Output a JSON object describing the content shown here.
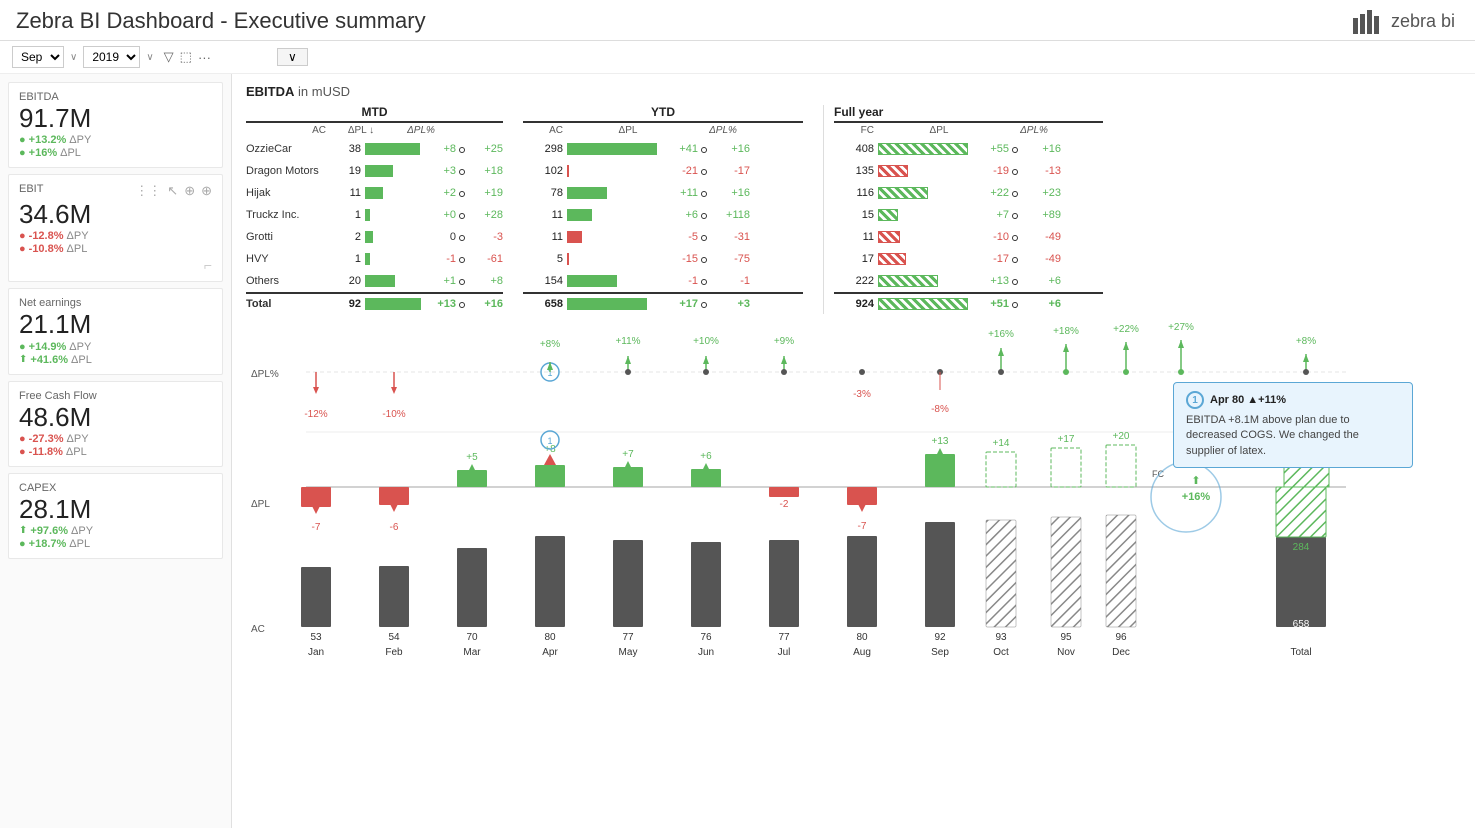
{
  "header": {
    "title": "Zebra BI Dashboard - Executive summary",
    "logo": "zebra bi",
    "logo_icon": "bar-chart-icon"
  },
  "toolbar": {
    "month_select": "Sep",
    "year_select": "2019",
    "filter_label": "Filter",
    "collapse_label": "∨"
  },
  "kpis": [
    {
      "id": "ebitda",
      "label": "EBITDA",
      "value": "91.7M",
      "metrics": [
        {
          "sign": "+",
          "val": "+13.2%",
          "type": "green",
          "tag": "ΔPY"
        },
        {
          "sign": "+",
          "val": "+16%",
          "type": "green",
          "tag": "ΔPL"
        }
      ]
    },
    {
      "id": "ebit",
      "label": "EBIT",
      "value": "34.6M",
      "metrics": [
        {
          "sign": "-",
          "val": "-12.8%",
          "type": "red",
          "tag": "ΔPY"
        },
        {
          "sign": "-",
          "val": "-10.8%",
          "type": "red",
          "tag": "ΔPL"
        }
      ]
    },
    {
      "id": "net-earnings",
      "label": "Net earnings",
      "value": "21.1M",
      "metrics": [
        {
          "sign": "+",
          "val": "+14.9%",
          "type": "green",
          "tag": "ΔPY"
        },
        {
          "sign": "+",
          "val": "+41.6%",
          "type": "green",
          "tag": "ΔPL"
        }
      ]
    },
    {
      "id": "free-cash-flow",
      "label": "Free Cash Flow",
      "value": "48.6M",
      "metrics": [
        {
          "sign": "-",
          "val": "-27.3%",
          "type": "red",
          "tag": "ΔPY"
        },
        {
          "sign": "-",
          "val": "-11.8%",
          "type": "red",
          "tag": "ΔPL"
        }
      ]
    },
    {
      "id": "capex",
      "label": "CAPEX",
      "value": "28.1M",
      "metrics": [
        {
          "sign": "+",
          "val": "+97.6%",
          "type": "green",
          "tag": "ΔPY"
        },
        {
          "sign": "+",
          "val": "+18.7%",
          "type": "green",
          "tag": "ΔPL"
        }
      ]
    }
  ],
  "ebitda_title": "EBITDA",
  "ebitda_unit": "in mUSD",
  "mtd_header": "MTD",
  "ytd_header": "YTD",
  "full_year_header": "Full year",
  "col_headers": {
    "ac": "AC",
    "dpl_down": "ΔPL ↓",
    "dpl_pct": "ΔPL%",
    "fc": "FC",
    "dpl": "ΔPL",
    "dpl_pct2": "ΔPL%"
  },
  "table_rows": [
    {
      "name": "OzzieCar",
      "mtd_ac": 38,
      "mtd_bar_w": 55,
      "mtd_dpl": "+8",
      "mtd_dpl_pct": "+25",
      "ytd_ac": 298,
      "ytd_bar_w": 90,
      "ytd_dpl": "+41",
      "ytd_dpl_pct": "+16",
      "fy_fc": 408,
      "fy_bar_w": 90,
      "fy_dpl": "+55",
      "fy_dpl_pct": "+16",
      "ytd_bar_color": "green",
      "fy_bar_type": "hatch"
    },
    {
      "name": "Dragon Motors",
      "mtd_ac": 19,
      "mtd_bar_w": 28,
      "mtd_dpl": "+3",
      "mtd_dpl_pct": "+18",
      "ytd_ac": 102,
      "ytd_bar_w": 0,
      "ytd_dpl": "-21",
      "ytd_dpl_pct": "-17",
      "fy_fc": 135,
      "fy_bar_w": 30,
      "fy_dpl": "-19",
      "fy_dpl_pct": "-13",
      "ytd_bar_color": "red",
      "fy_bar_type": "hatch-red"
    },
    {
      "name": "Hijak",
      "mtd_ac": 11,
      "mtd_bar_w": 18,
      "mtd_dpl": "+2",
      "mtd_dpl_pct": "+19",
      "ytd_ac": 78,
      "ytd_bar_w": 40,
      "ytd_dpl": "+11",
      "ytd_dpl_pct": "+16",
      "fy_fc": 116,
      "fy_bar_w": 50,
      "fy_dpl": "+22",
      "fy_dpl_pct": "+23",
      "ytd_bar_color": "green",
      "fy_bar_type": "hatch"
    },
    {
      "name": "Truckz Inc.",
      "mtd_ac": 1,
      "mtd_bar_w": 5,
      "mtd_dpl": "+0",
      "mtd_dpl_pct": "+28",
      "ytd_ac": 11,
      "ytd_bar_w": 25,
      "ytd_dpl": "+6",
      "ytd_dpl_pct": "+118",
      "fy_fc": 15,
      "fy_bar_w": 20,
      "fy_dpl": "+7",
      "fy_dpl_pct": "+89",
      "ytd_bar_color": "green",
      "fy_bar_type": "hatch"
    },
    {
      "name": "Grotti",
      "mtd_ac": 2,
      "mtd_bar_w": 8,
      "mtd_dpl": "0",
      "mtd_dpl_pct": "-3",
      "ytd_ac": 11,
      "ytd_bar_w": 15,
      "ytd_dpl": "-5",
      "ytd_dpl_pct": "-31",
      "fy_fc": 11,
      "fy_bar_w": 22,
      "fy_dpl": "-10",
      "fy_dpl_pct": "-49",
      "ytd_bar_color": "red",
      "fy_bar_type": "hatch-red"
    },
    {
      "name": "HVY",
      "mtd_ac": 1,
      "mtd_bar_w": 5,
      "mtd_dpl": "-1",
      "mtd_dpl_pct": "-61",
      "ytd_ac": 5,
      "ytd_bar_w": 0,
      "ytd_dpl": "-15",
      "ytd_dpl_pct": "-75",
      "fy_fc": 17,
      "fy_bar_w": 28,
      "fy_dpl": "-17",
      "fy_dpl_pct": "-49",
      "ytd_bar_color": "red",
      "fy_bar_type": "hatch-red"
    },
    {
      "name": "Others",
      "mtd_ac": 20,
      "mtd_bar_w": 30,
      "mtd_dpl": "+1",
      "mtd_dpl_pct": "+8",
      "ytd_ac": 154,
      "ytd_bar_w": 50,
      "ytd_dpl": "-1",
      "ytd_dpl_pct": "-1",
      "fy_fc": 222,
      "fy_bar_w": 60,
      "fy_dpl": "+13",
      "fy_dpl_pct": "+6",
      "ytd_bar_color": "green",
      "fy_bar_type": "hatch"
    },
    {
      "name": "Total",
      "mtd_ac": 92,
      "mtd_bar_w": 70,
      "mtd_dpl": "+13",
      "mtd_dpl_pct": "+16",
      "ytd_ac": 658,
      "ytd_bar_w": 80,
      "ytd_dpl": "+17",
      "ytd_dpl_pct": "+3",
      "fy_fc": 924,
      "fy_bar_w": 90,
      "fy_dpl": "+51",
      "fy_dpl_pct": "+6",
      "ytd_bar_color": "green",
      "fy_bar_type": "hatch",
      "is_total": true
    }
  ],
  "waterfall": {
    "months": [
      "Jan",
      "Feb",
      "Mar",
      "Apr",
      "May",
      "Jun",
      "Jul",
      "Aug",
      "Sep",
      "Oct",
      "Nov",
      "Dec",
      "Total"
    ],
    "ac_values": [
      53,
      54,
      70,
      80,
      77,
      76,
      77,
      80,
      92,
      93,
      95,
      96,
      658
    ],
    "dpl_values": [
      -7,
      -6,
      5,
      8,
      7,
      6,
      -2,
      -7,
      13,
      14,
      17,
      20,
      284
    ],
    "dpl_pct_top": [
      "-12%",
      "-10%",
      null,
      "+8%",
      "+11%",
      "+10%",
      "+9%",
      null,
      "+16%",
      "+18%",
      "+22%",
      "+27%",
      "+8%"
    ],
    "dpl_pct_bottom": [
      null,
      null,
      null,
      null,
      null,
      null,
      null,
      "-3%",
      null,
      null,
      null,
      null,
      null
    ],
    "aug_neg": "-8%",
    "highlight_month": "Sep",
    "annotation": {
      "circle_num": "1",
      "title": "Apr 80 ▲+11%",
      "body": "EBITDA +8.1M above plan due to decreased COGS. We changed the supplier of latex.",
      "apr_circle_num": "1"
    }
  },
  "colors": {
    "green": "#5cb85c",
    "red": "#d9534f",
    "dark_bar": "#555",
    "hatch_green": "#5cb85c",
    "hatch_red": "#d9534f",
    "blue_annotation": "#5ba7d5"
  }
}
